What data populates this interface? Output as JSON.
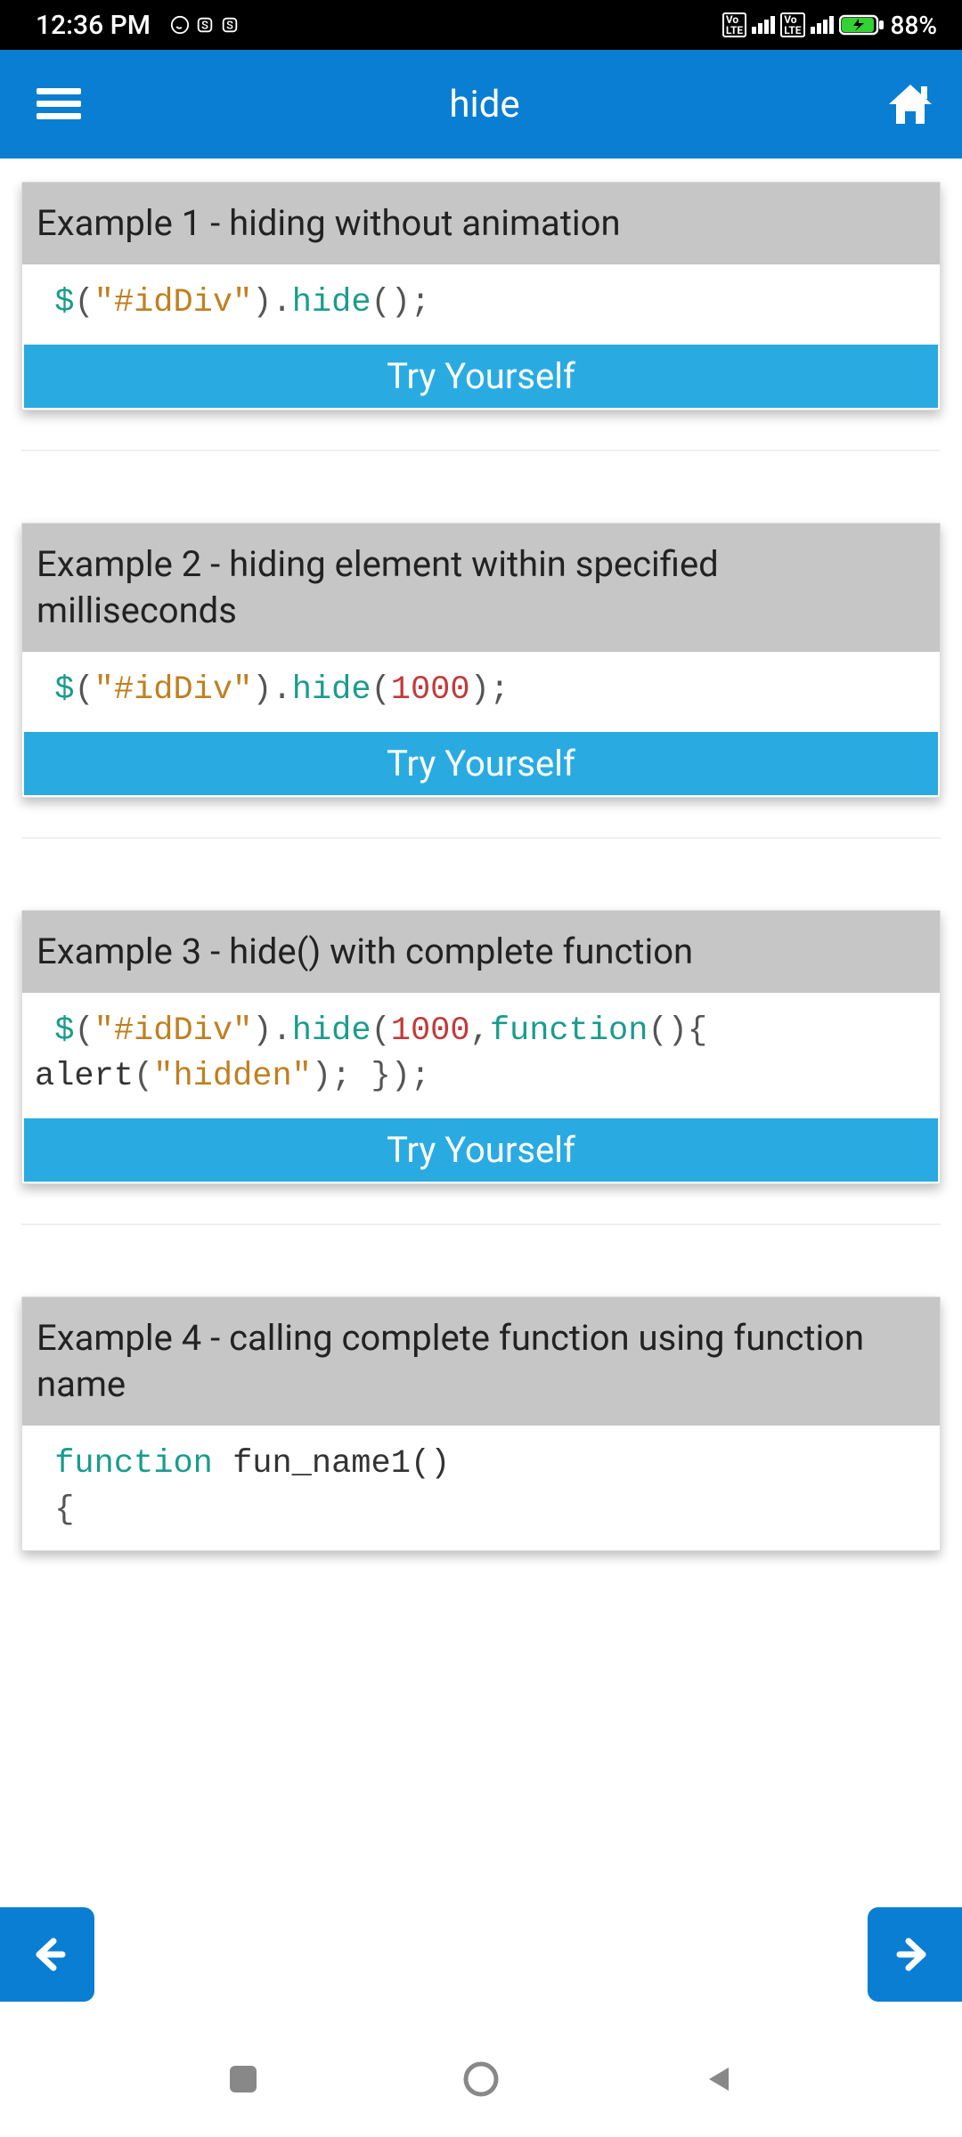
{
  "status": {
    "time": "12:36 PM",
    "battery": "88%"
  },
  "header": {
    "title": "hide"
  },
  "try_label": "Try Yourself",
  "examples": [
    {
      "title": "Example 1 - hiding without animation",
      "code_tokens": [
        {
          "t": " ",
          "cls": ""
        },
        {
          "t": "$",
          "cls": "tok-dollar"
        },
        {
          "t": "(",
          "cls": "tok-punct"
        },
        {
          "t": "\"#idDiv\"",
          "cls": "tok-string"
        },
        {
          "t": ").",
          "cls": "tok-punct"
        },
        {
          "t": "hide",
          "cls": "tok-method"
        },
        {
          "t": "();",
          "cls": "tok-punct"
        }
      ]
    },
    {
      "title": "Example 2 - hiding element within specified milliseconds",
      "code_tokens": [
        {
          "t": " ",
          "cls": ""
        },
        {
          "t": "$",
          "cls": "tok-dollar"
        },
        {
          "t": "(",
          "cls": "tok-punct"
        },
        {
          "t": "\"#idDiv\"",
          "cls": "tok-string"
        },
        {
          "t": ").",
          "cls": "tok-punct"
        },
        {
          "t": "hide",
          "cls": "tok-method"
        },
        {
          "t": "(",
          "cls": "tok-punct"
        },
        {
          "t": "1000",
          "cls": "tok-number"
        },
        {
          "t": ");",
          "cls": "tok-punct"
        }
      ]
    },
    {
      "title": "Example 3 - hide() with complete function",
      "code_tokens": [
        {
          "t": " ",
          "cls": ""
        },
        {
          "t": "$",
          "cls": "tok-dollar"
        },
        {
          "t": "(",
          "cls": "tok-punct"
        },
        {
          "t": "\"#idDiv\"",
          "cls": "tok-string"
        },
        {
          "t": ").",
          "cls": "tok-punct"
        },
        {
          "t": "hide",
          "cls": "tok-method"
        },
        {
          "t": "(",
          "cls": "tok-punct"
        },
        {
          "t": "1000",
          "cls": "tok-number"
        },
        {
          "t": ",",
          "cls": "tok-punct"
        },
        {
          "t": "function",
          "cls": "tok-keyword"
        },
        {
          "t": "(){ ",
          "cls": "tok-punct"
        },
        {
          "t": "\n",
          "cls": ""
        },
        {
          "t": "alert",
          "cls": "tok-ident"
        },
        {
          "t": "(",
          "cls": "tok-punct"
        },
        {
          "t": "\"hidden\"",
          "cls": "tok-string"
        },
        {
          "t": "); });",
          "cls": "tok-punct"
        }
      ]
    },
    {
      "title": "Example 4 - calling complete function using function name",
      "code_tokens": [
        {
          "t": " ",
          "cls": ""
        },
        {
          "t": "function",
          "cls": "tok-keyword"
        },
        {
          "t": " fun_name1()",
          "cls": "tok-ident"
        },
        {
          "t": "\n",
          "cls": ""
        },
        {
          "t": " {",
          "cls": "tok-punct"
        }
      ],
      "no_button": true
    }
  ]
}
